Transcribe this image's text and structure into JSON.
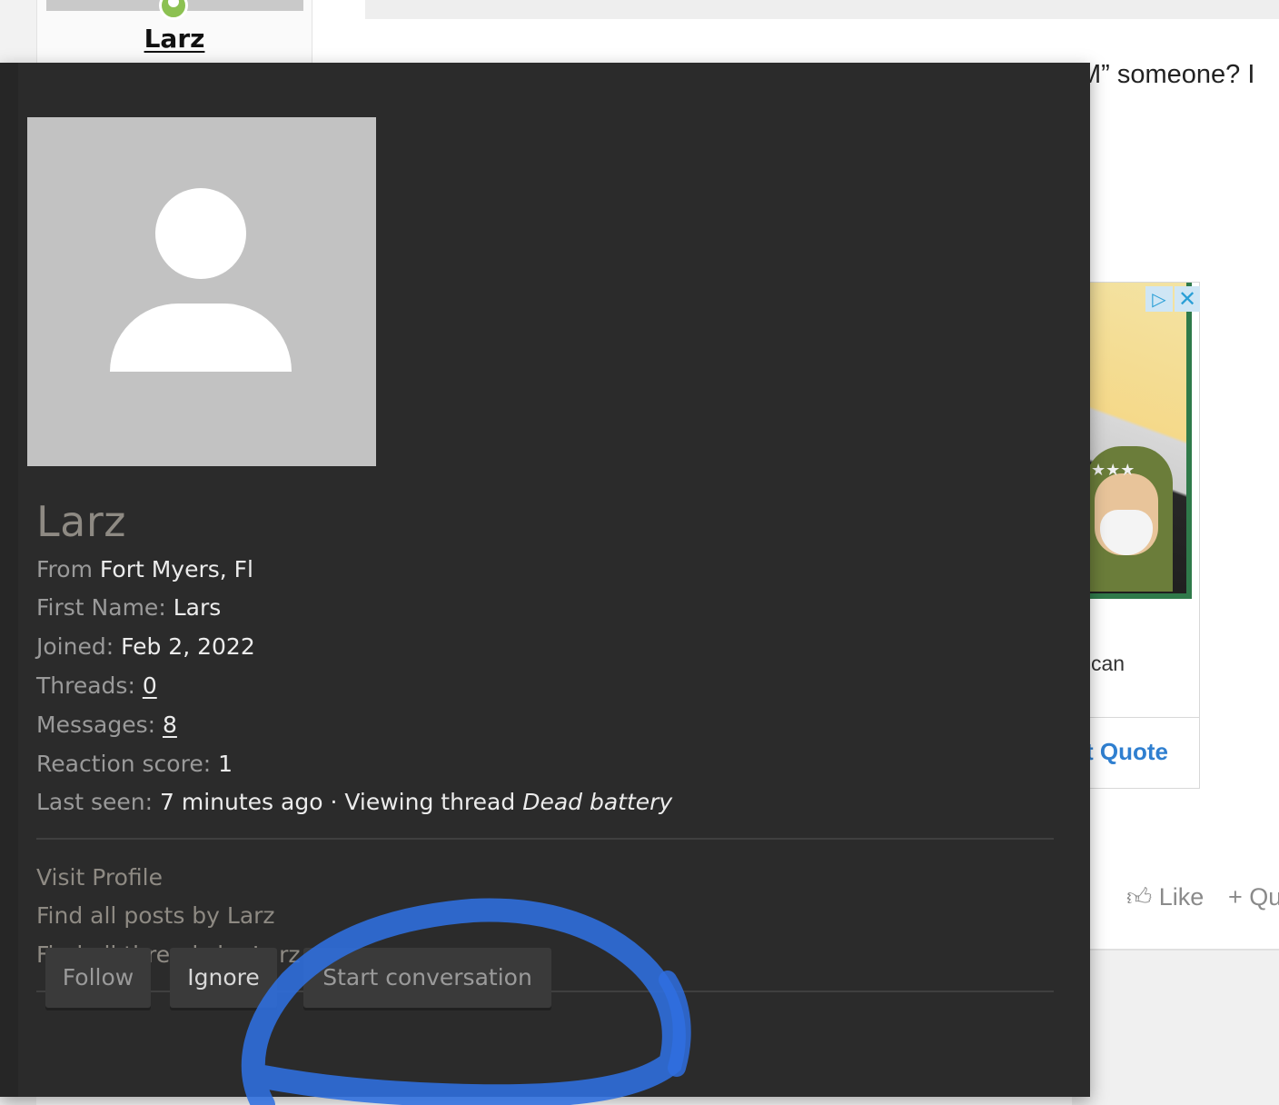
{
  "background": {
    "author_username": "Larz",
    "post_text_fragment": "M” someone? I",
    "ad": {
      "text_fragment": "can",
      "cta_fragment": "t Quote",
      "choices_icon": "ad-choices-icon",
      "close_icon": "close-icon"
    },
    "actions": {
      "like_label": "Like",
      "quote_label": "+ Qu"
    }
  },
  "popup": {
    "name": "Larz",
    "from_label": "From",
    "from_value": "Fort Myers, Fl",
    "first_name_label": "First Name:",
    "first_name_value": "Lars",
    "joined_label": "Joined:",
    "joined_value": "Feb 2, 2022",
    "threads_label": "Threads:",
    "threads_value": "0",
    "messages_label": "Messages:",
    "messages_value": "8",
    "reaction_label": "Reaction score:",
    "reaction_value": "1",
    "last_seen_label": "Last seen:",
    "last_seen_value": "7 minutes ago · Viewing thread",
    "last_seen_thread": "Dead battery",
    "links": {
      "visit_profile": "Visit Profile",
      "find_posts": "Find all posts by Larz",
      "find_threads": "Find all threads by Larz"
    },
    "buttons": {
      "follow": "Follow",
      "ignore": "Ignore",
      "start_conversation": "Start conversation"
    }
  },
  "colors": {
    "popup_bg": "#2b2b2b",
    "annotation_blue": "#2f6fe0",
    "online": "#8cc152",
    "ad_cta": "#2f7fd0"
  }
}
